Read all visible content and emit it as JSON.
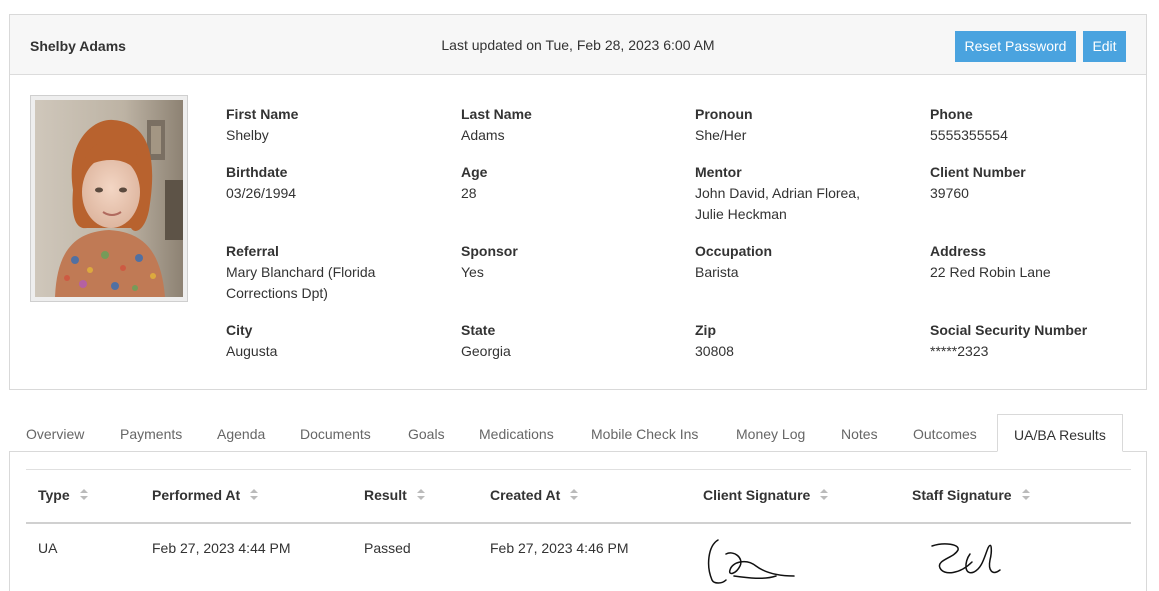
{
  "header": {
    "client_name": "Shelby Adams",
    "last_updated": "Last updated on Tue, Feb 28, 2023 6:00 AM",
    "reset_password_label": "Reset Password",
    "edit_label": "Edit"
  },
  "profile": {
    "fields": [
      {
        "label": "First Name",
        "value": "Shelby"
      },
      {
        "label": "Last Name",
        "value": "Adams"
      },
      {
        "label": "Pronoun",
        "value": "She/Her"
      },
      {
        "label": "Phone",
        "value": "5555355554"
      },
      {
        "label": "Birthdate",
        "value": "03/26/1994"
      },
      {
        "label": "Age",
        "value": "28"
      },
      {
        "label": "Mentor",
        "value": "John David, Adrian Florea, Julie Heckman"
      },
      {
        "label": "Client Number",
        "value": "39760"
      },
      {
        "label": "Referral",
        "value": "Mary Blanchard (Florida Corrections Dpt)"
      },
      {
        "label": "Sponsor",
        "value": "Yes"
      },
      {
        "label": "Occupation",
        "value": "Barista"
      },
      {
        "label": "Address",
        "value": "22 Red Robin Lane"
      },
      {
        "label": "City",
        "value": "Augusta"
      },
      {
        "label": "State",
        "value": "Georgia"
      },
      {
        "label": "Zip",
        "value": "30808"
      },
      {
        "label": "Social Security Number",
        "value": "*****2323"
      }
    ]
  },
  "tabs": [
    "Overview",
    "Payments",
    "Agenda",
    "Documents",
    "Goals",
    "Medications",
    "Mobile Check Ins",
    "Money Log",
    "Notes",
    "Outcomes",
    "UA/BA Results"
  ],
  "active_tab": "UA/BA Results",
  "table": {
    "columns": [
      "Type",
      "Performed At",
      "Result",
      "Created At",
      "Client Signature",
      "Staff Signature"
    ],
    "rows": [
      {
        "type": "UA",
        "performed_at": "Feb 27, 2023 4:44 PM",
        "result": "Passed",
        "created_at": "Feb 27, 2023 4:46 PM"
      }
    ]
  },
  "colors": {
    "button_bg": "#4aa3df",
    "header_bg": "#f7f7f7",
    "border": "#d9d9d9"
  }
}
